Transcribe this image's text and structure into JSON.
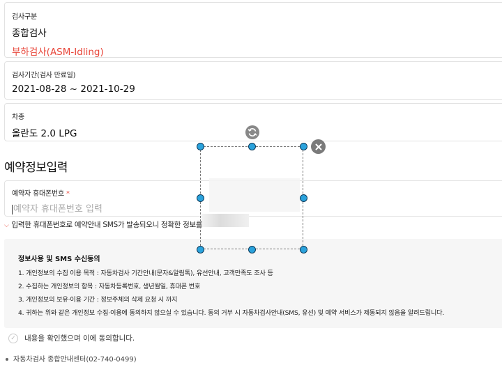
{
  "inspection_type": {
    "label": "검사구분",
    "value": "종합검사",
    "sub_value": "부하검사(ASM-Idling)"
  },
  "inspection_period": {
    "label": "검사기간(검사 만료일)",
    "value": "2021-08-28 ~ 2021-10-29"
  },
  "vehicle_type": {
    "label": "차종",
    "value": "올란도 2.0 LPG"
  },
  "reservation_section": {
    "title": "예약정보입력"
  },
  "phone_field": {
    "label": "예약자 휴대폰번호",
    "required_mark": "*",
    "placeholder": "예약자 휴대폰번호 입력"
  },
  "phone_hint": "입력한 휴대폰번호로 예약안내 SMS가 발송되오니 정확한 정보를",
  "consent": {
    "title": "정보사용 및 SMS 수신동의",
    "lines": [
      "1. 개인정보의 수집 이용 목적 : 자동차검사 기간안내(문자&알림톡), 유선안내, 고객만족도 조사 등",
      "2. 수집하는 개인정보의 항목 : 자동차등록번호, 생년월일, 휴대폰 번호",
      "3. 개인정보의 보유·이용 기간 : 정보주체의 삭제 요청 시 까지",
      "4. 귀하는 위와 같은 개인정보 수집·이용에 동의하지 않으실 수 있습니다. 동의 거부 시 자동차검사안내(SMS, 유선) 및 예약 서비스가 제동되지 않음을 알려드립니다."
    ]
  },
  "agree_checkbox": {
    "label": "내용을 확인했으며 이에 동의합니다.",
    "checked": false
  },
  "center_info": "자동차검사 종합안내센터(02-740-0499)",
  "crop_overlay": {
    "rotate_icon": "rotate-icon",
    "close_icon": "close-icon"
  },
  "colors": {
    "accent_red": "#e8463a",
    "handle_blue": "#2aa2dc"
  }
}
